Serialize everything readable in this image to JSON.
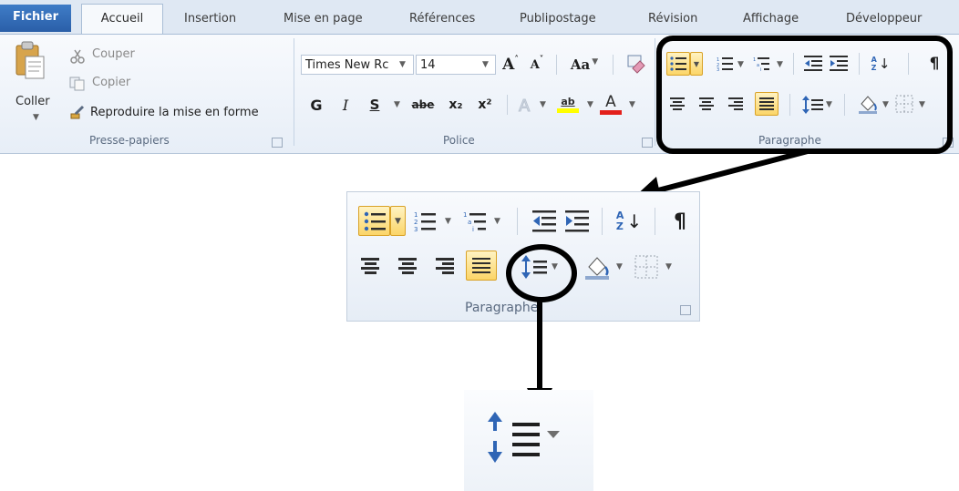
{
  "tabs": {
    "file": "Fichier",
    "home": "Accueil",
    "insert": "Insertion",
    "layout": "Mise en page",
    "references": "Références",
    "mailings": "Publipostage",
    "review": "Révision",
    "view": "Affichage",
    "developer": "Développeur"
  },
  "clipboard": {
    "paste_label": "Coller",
    "cut_label": "Couper",
    "copy_label": "Copier",
    "format_painter_label": "Reproduire la mise en forme",
    "group_label": "Presse-papiers"
  },
  "font": {
    "font_name": "Times New Rc",
    "font_size": "14",
    "grow_glyph": "A",
    "shrink_glyph": "A",
    "case_glyph": "Aa",
    "bold_glyph": "G",
    "italic_glyph": "I",
    "underline_glyph": "S",
    "strike_glyph": "abe",
    "subscript_glyph": "x₂",
    "superscript_glyph": "x²",
    "highlight_glyph": "ab",
    "font_color_glyph": "A",
    "group_label": "Police"
  },
  "paragraph": {
    "group_label": "Paragraphe",
    "sort_glyph_a": "A",
    "sort_glyph_z": "Z",
    "pilcrow_glyph": "¶",
    "highlight_color": "#fbd568",
    "accent_color": "#2f65b5"
  },
  "zoom_panel": {
    "group_label": "Paragraphe"
  },
  "colors": {
    "tab_bar": "#dfe8f3",
    "file_tab": "#2a5fa8",
    "annotation": "#000000"
  }
}
